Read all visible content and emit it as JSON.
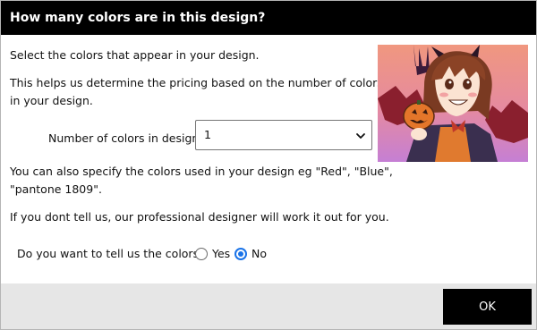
{
  "dialog": {
    "title": "How many colors are in this design?"
  },
  "content": {
    "line1": "Select the colors that appear in your design.",
    "line2a": "This helps us determine the pricing based on the number of colors",
    "line2b": "in your design.",
    "count_label": "Number of colors in design",
    "count_value": "1",
    "line3a": "You can also specify the colors used in your design eg \"Red\", \"Blue\",",
    "line3b": "\"pantone 1809\".",
    "line4": "If you dont tell us, our professional designer will work it out for you."
  },
  "radio": {
    "question": "Do you want to tell us the colors?",
    "yes_label": "Yes",
    "no_label": "No",
    "selected": "No"
  },
  "footer": {
    "ok_label": "OK"
  },
  "colors": {
    "title_bar": "#000000",
    "accent": "#1a73e8",
    "footer_bg": "#e6e6e6",
    "ok_button": "#000000"
  },
  "icons": {
    "select_arrow": "chevron-down-icon",
    "preview": "design-preview-image"
  }
}
